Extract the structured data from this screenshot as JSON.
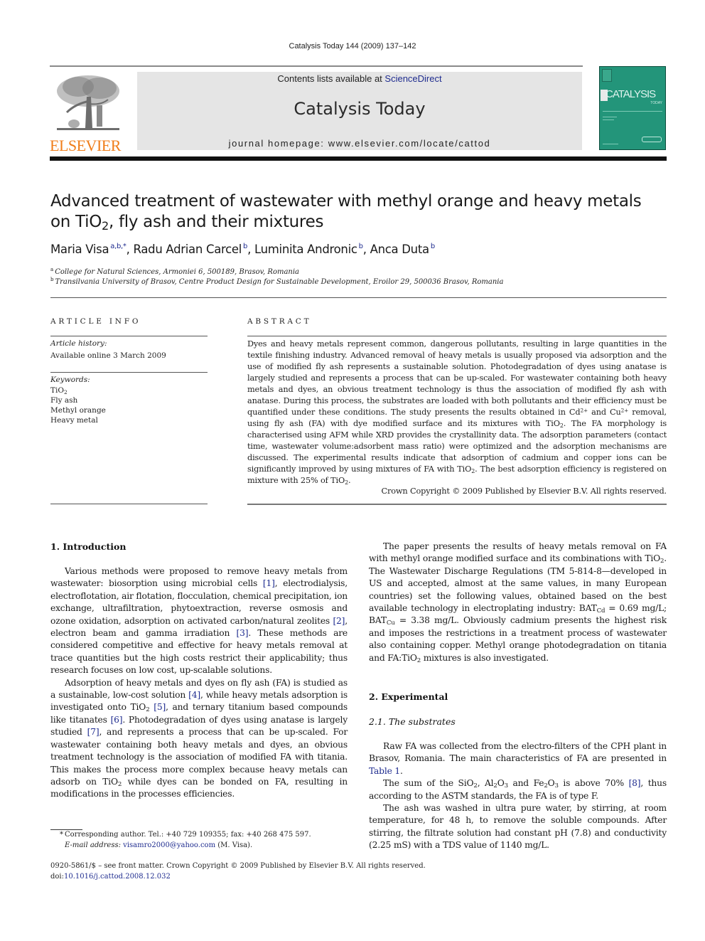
{
  "running_head": "Catalysis Today 144 (2009) 137–142",
  "banner": {
    "contents_prefix": "Contents lists available at ",
    "contents_link": "ScienceDirect",
    "journal_name": "Catalysis Today",
    "homepage": "journal homepage: www.elsevier.com/locate/cattod"
  },
  "publisher_logo": {
    "wordmark": "ELSEVIER",
    "icon": "elsevier-tree-logo",
    "color": "#f07d1a"
  },
  "cover": {
    "title": "CATALYSIS",
    "subtitle": "TODAY",
    "color": "#23957a"
  },
  "article": {
    "title_line1": "Advanced treatment of wastewater with methyl orange and heavy metals",
    "title_line2_prefix": "on TiO",
    "title_line2_sub": "2",
    "title_line2_suffix": ", fly ash and their mixtures",
    "authors": [
      {
        "name": "Maria Visa",
        "aff": "a,b,*"
      },
      {
        "name": "Radu Adrian Carcel",
        "aff": "b"
      },
      {
        "name": "Luminita Andronic",
        "aff": "b"
      },
      {
        "name": "Anca Duta",
        "aff": "b"
      }
    ],
    "affiliations": [
      {
        "mark": "a",
        "text": "College for Natural Sciences, Armoniei 6, 500189, Brasov, Romania"
      },
      {
        "mark": "b",
        "text": "Transilvania University of Brasov, Centre Product Design for Sustainable Development, Eroilor 29, 500036 Brasov, Romania"
      }
    ]
  },
  "article_info": {
    "heading": "ARTICLE INFO",
    "history_label": "Article history:",
    "history_value": "Available online 3 March 2009",
    "keywords_label": "Keywords:",
    "keywords": [
      "TiO2",
      "Fly ash",
      "Methyl orange",
      "Heavy metal"
    ]
  },
  "abstract": {
    "heading": "ABSTRACT",
    "text_parts": [
      "Dyes and heavy metals represent common, dangerous pollutants, resulting in large quantities in the textile finishing industry. Advanced removal of heavy metals is usually proposed via adsorption and the use of modified fly ash represents a sustainable solution. Photodegradation of dyes using anatase is largely studied and represents a process that can be up-scaled. For wastewater containing both heavy metals and dyes, an obvious treatment technology is thus the association of modified fly ash with anatase. During this process, the substrates are loaded with both pollutants and their efficiency must be quantified under these conditions. The study presents the results obtained in Cd",
      " and Cu",
      " removal, using fly ash (FA) with dye modified surface and its mixtures with TiO",
      ". The FA morphology is characterised using AFM while XRD provides the crystallinity data. The adsorption parameters (contact time, wastewater volume:adsorbent mass ratio) were optimized and the adsorption mechanisms are discussed. The experimental results indicate that adsorption of cadmium and copper ions can be significantly improved by using mixtures of FA with TiO",
      ". The best adsorption efficiency is registered on mixture with 25% of TiO",
      "."
    ],
    "ion_charge": "2+",
    "subscript_2": "2",
    "copyright": "Crown Copyright © 2009 Published by Elsevier B.V. All rights reserved."
  },
  "intro": {
    "heading": "1.  Introduction",
    "p1": [
      "Various methods were proposed to remove heavy metals from wastewater: biosorption using microbial cells ",
      ", electrodialysis, electroflotation, air flotation, flocculation, chemical precipitation, ion exchange, ultrafiltration, phytoextraction, reverse osmosis and ozone oxidation, adsorption on activated carbon/natural zeolites ",
      ", electron beam and gamma irradiation ",
      ". These methods are considered competitive and effective for heavy metals removal at trace quantities but the high costs restrict their applicability; thus research focuses on low cost, up-scalable solutions."
    ],
    "p2": [
      "Adsorption of heavy metals and dyes on fly ash (FA) is studied as a sustainable, low-cost solution ",
      ", while heavy metals adsorption is investigated onto TiO",
      " ",
      ", and ternary titanium based compounds like titanates ",
      ". Photodegradation of dyes using anatase is largely studied ",
      ", and represents a process that can be up-scaled. For wastewater containing both heavy metals and dyes, an obvious treatment technology is the association of modified FA with titania. This makes the process more complex because heavy metals can adsorb on TiO",
      " while dyes can be bonded on FA, resulting in modifications in the processes efficiencies."
    ],
    "refs": [
      "[1]",
      "[2]",
      "[3]",
      "[4]",
      "[5]",
      "[6]",
      "[7]",
      "[8]"
    ],
    "p3": [
      "The paper presents the results of heavy metals removal on FA with methyl orange modified surface and its combinations with TiO",
      ". The Wastewater Discharge Regulations (TM 5-814-8—developed in US and accepted, almost at the same values, in many European countries) set the following values, obtained based on the best available technology in electroplating industry: BAT",
      " = 0.69 mg/L;  BAT",
      " = 3.38 mg/L. Obviously cadmium presents the highest risk and imposes the restrictions in a treatment process of wastewater also containing copper. Methyl orange photodegradation on titania and FA:TiO",
      " mixtures is also investigated."
    ],
    "sub_cd": "Cd",
    "sub_cu": "Cu"
  },
  "experimental": {
    "heading": "2.  Experimental",
    "subheading": "2.1.  The substrates",
    "p1_text": "Raw FA was collected from the electro-filters of the CPH plant in Brasov, Romania. The main characteristics of FA are presented in ",
    "p1_link": "Table 1",
    "p1_end": ".",
    "p2": [
      "The sum of the SiO",
      ", Al",
      "O",
      " and Fe",
      "O",
      " is above 70% ",
      ", thus according to the ASTM standards, the FA is of type F."
    ],
    "sub3": "3",
    "p3": "The ash was washed in ultra pure water, by stirring, at room temperature, for 48 h, to remove the soluble compounds. After stirring, the filtrate solution had constant pH (7.8) and conductivity (2.25 mS) with a TDS value of 1140 mg/L."
  },
  "footnote": {
    "star": "*",
    "corresponding": "Corresponding author. Tel.: +40 729 109355; fax: +40 268 475 597.",
    "email_label": "E-mail address:",
    "email": "visamro2000@yahoo.com",
    "email_suffix": " (M. Visa)."
  },
  "front_matter": {
    "issn_line": "0920-5861/$ – see front matter. Crown Copyright © 2009 Published by Elsevier B.V. All rights reserved.",
    "doi_label": "doi:",
    "doi": "10.1016/j.cattod.2008.12.032"
  }
}
